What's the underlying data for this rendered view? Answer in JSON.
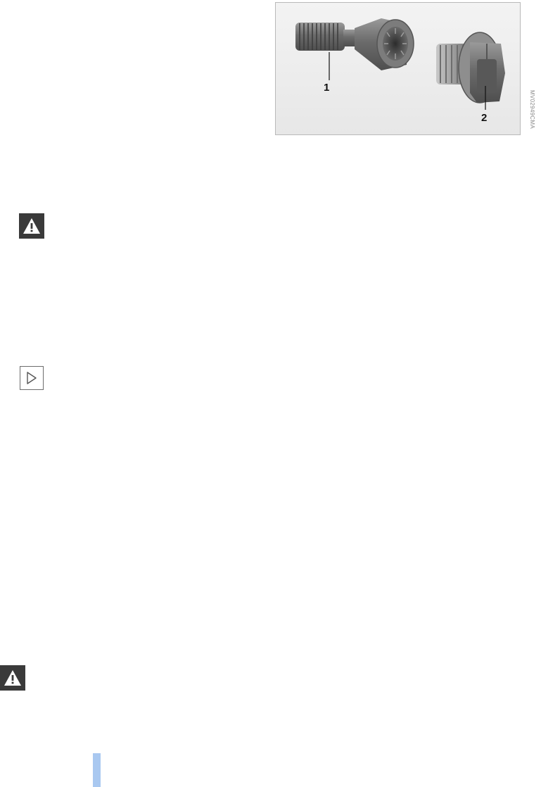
{
  "figure": {
    "callouts": [
      "1",
      "2"
    ],
    "code": "MV02949CMA"
  },
  "icons": {
    "warning_top": "warning-triangle-icon",
    "note": "note-arrow-icon",
    "warning_bottom": "warning-triangle-icon"
  },
  "colors": {
    "page_marker": "#a9c8f0",
    "icon_dark": "#3a3a3a"
  }
}
